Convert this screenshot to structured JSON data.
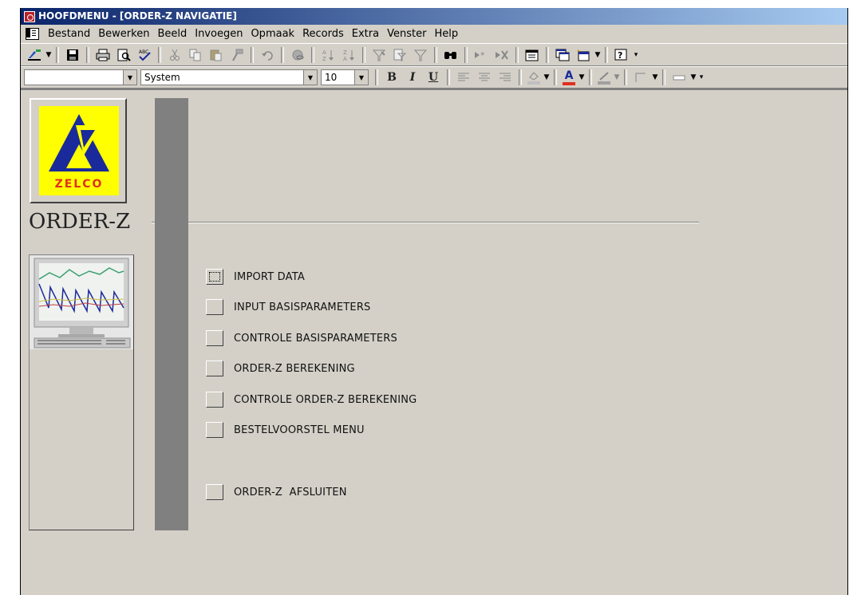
{
  "window": {
    "title": "HOOFDMENU - [ORDER-Z NAVIGATIE]"
  },
  "menubar": {
    "items": [
      "Bestand",
      "Bewerken",
      "Beeld",
      "Invoegen",
      "Opmaak",
      "Records",
      "Extra",
      "Venster",
      "Help"
    ]
  },
  "toolbar1": {
    "icons": [
      "design-view-icon",
      "save-icon",
      "print-icon",
      "print-preview-icon",
      "spelling-icon",
      "cut-icon",
      "copy-icon",
      "paste-icon",
      "format-painter-icon",
      "undo-icon",
      "hyperlink-icon",
      "sort-ascending-icon",
      "sort-descending-icon",
      "filter-by-selection-icon",
      "filter-by-form-icon",
      "apply-filter-icon",
      "find-icon",
      "new-record-icon",
      "delete-record-icon",
      "properties-icon",
      "database-window-icon",
      "new-object-icon",
      "help-icon"
    ]
  },
  "toolbar2": {
    "object_combo": "",
    "font_combo": "System",
    "size_combo": "10",
    "bold": "B",
    "italic": "I",
    "underline": "U",
    "font_color_letter": "A"
  },
  "colors": {
    "title_start": "#0a246a",
    "title_end": "#a6caf0",
    "form_bg": "#d4d0c8",
    "logo_yellow": "#ffff00",
    "logo_blue": "#1a2a9a",
    "logo_red": "#e0301e"
  },
  "form": {
    "logo_text": "ZELCO",
    "app_title": "ORDER-Z",
    "buttons": [
      {
        "label": "IMPORT DATA",
        "focused": true
      },
      {
        "label": "INPUT BASISPARAMETERS",
        "focused": false
      },
      {
        "label": "CONTROLE BASISPARAMETERS",
        "focused": false
      },
      {
        "label": "ORDER-Z BEREKENING",
        "focused": false
      },
      {
        "label": "CONTROLE ORDER-Z BEREKENING",
        "focused": false
      },
      {
        "label": "BESTELVOORSTEL MENU",
        "focused": false
      },
      {
        "label": "ORDER-Z  AFSLUITEN",
        "focused": false
      }
    ]
  }
}
